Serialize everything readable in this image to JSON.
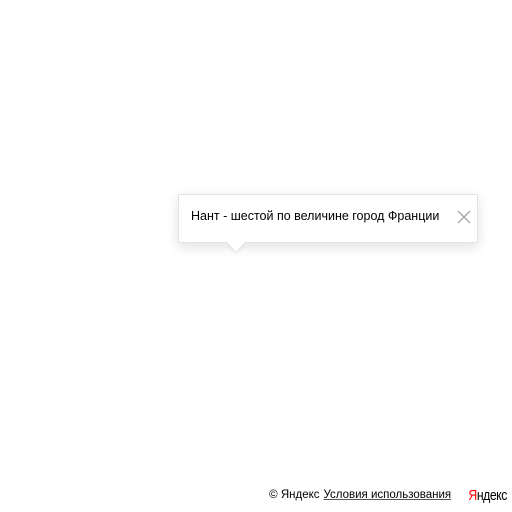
{
  "map": {
    "background_color": "#ffffff"
  },
  "balloon": {
    "text": "Нант - шестой по величине город Франции",
    "close_icon": "close-icon"
  },
  "copyright": {
    "text": "© Яндекс",
    "terms_link": "Условия использования",
    "logo": {
      "first_letter": "Я",
      "rest": "ндекс",
      "first_letter_color": "#ff0000"
    }
  }
}
